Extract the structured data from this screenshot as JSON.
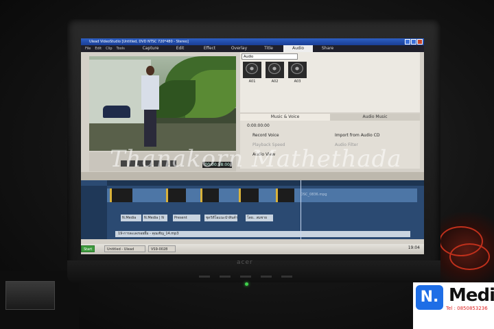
{
  "window_title": "Ulead VideoStudio [Untitled, DVD NTSC 720*480 - Stereo]",
  "menu": [
    "File",
    "Edit",
    "Clip",
    "Tools"
  ],
  "steps": [
    {
      "label": "Capture"
    },
    {
      "label": "Edit"
    },
    {
      "label": "Effect"
    },
    {
      "label": "Overlay"
    },
    {
      "label": "Title"
    },
    {
      "label": "Audio"
    },
    {
      "label": "Share"
    }
  ],
  "active_step": "Audio",
  "library": {
    "dropdown": "Audio",
    "items": [
      "A01",
      "A02",
      "A03"
    ]
  },
  "options": {
    "tabs": [
      "Music & Voice",
      "Audio Music"
    ],
    "timecode": "0:00:00:00",
    "record_voice": "Record Voice",
    "import_cd": "Import from Audio CD",
    "playback_speed": "Playback Speed",
    "audio_filter": "Audio Filter",
    "audio_view": "Audio View"
  },
  "preview": {
    "timecode": "00:00:58:00"
  },
  "timeline": {
    "video_clip": "DSC_0836.mpg",
    "titles": [
      "N.Media",
      "N.Media | N",
      "Present",
      "ชุดวิดีโอแนะนำสินค้า",
      "โดย.. สมชาย"
    ],
    "music": "19-การละเลงรอยยิ้ม - คุณเชิญ_14.mp3"
  },
  "taskbar": {
    "start": "Start",
    "items": [
      "Untitled - Ulead Video...",
      "VS9-0028"
    ],
    "clock": "19:04"
  },
  "watermark": "Thanakorn Mathethada",
  "logo": {
    "mark": "N.",
    "name": "Media",
    "tel": "Tel : 0850853236"
  },
  "colors": {
    "titlebar": "#2d5fc4",
    "timeline": "#2b4a72",
    "logo_blue": "#1e6ee6",
    "power_led": "#3fd24c"
  }
}
